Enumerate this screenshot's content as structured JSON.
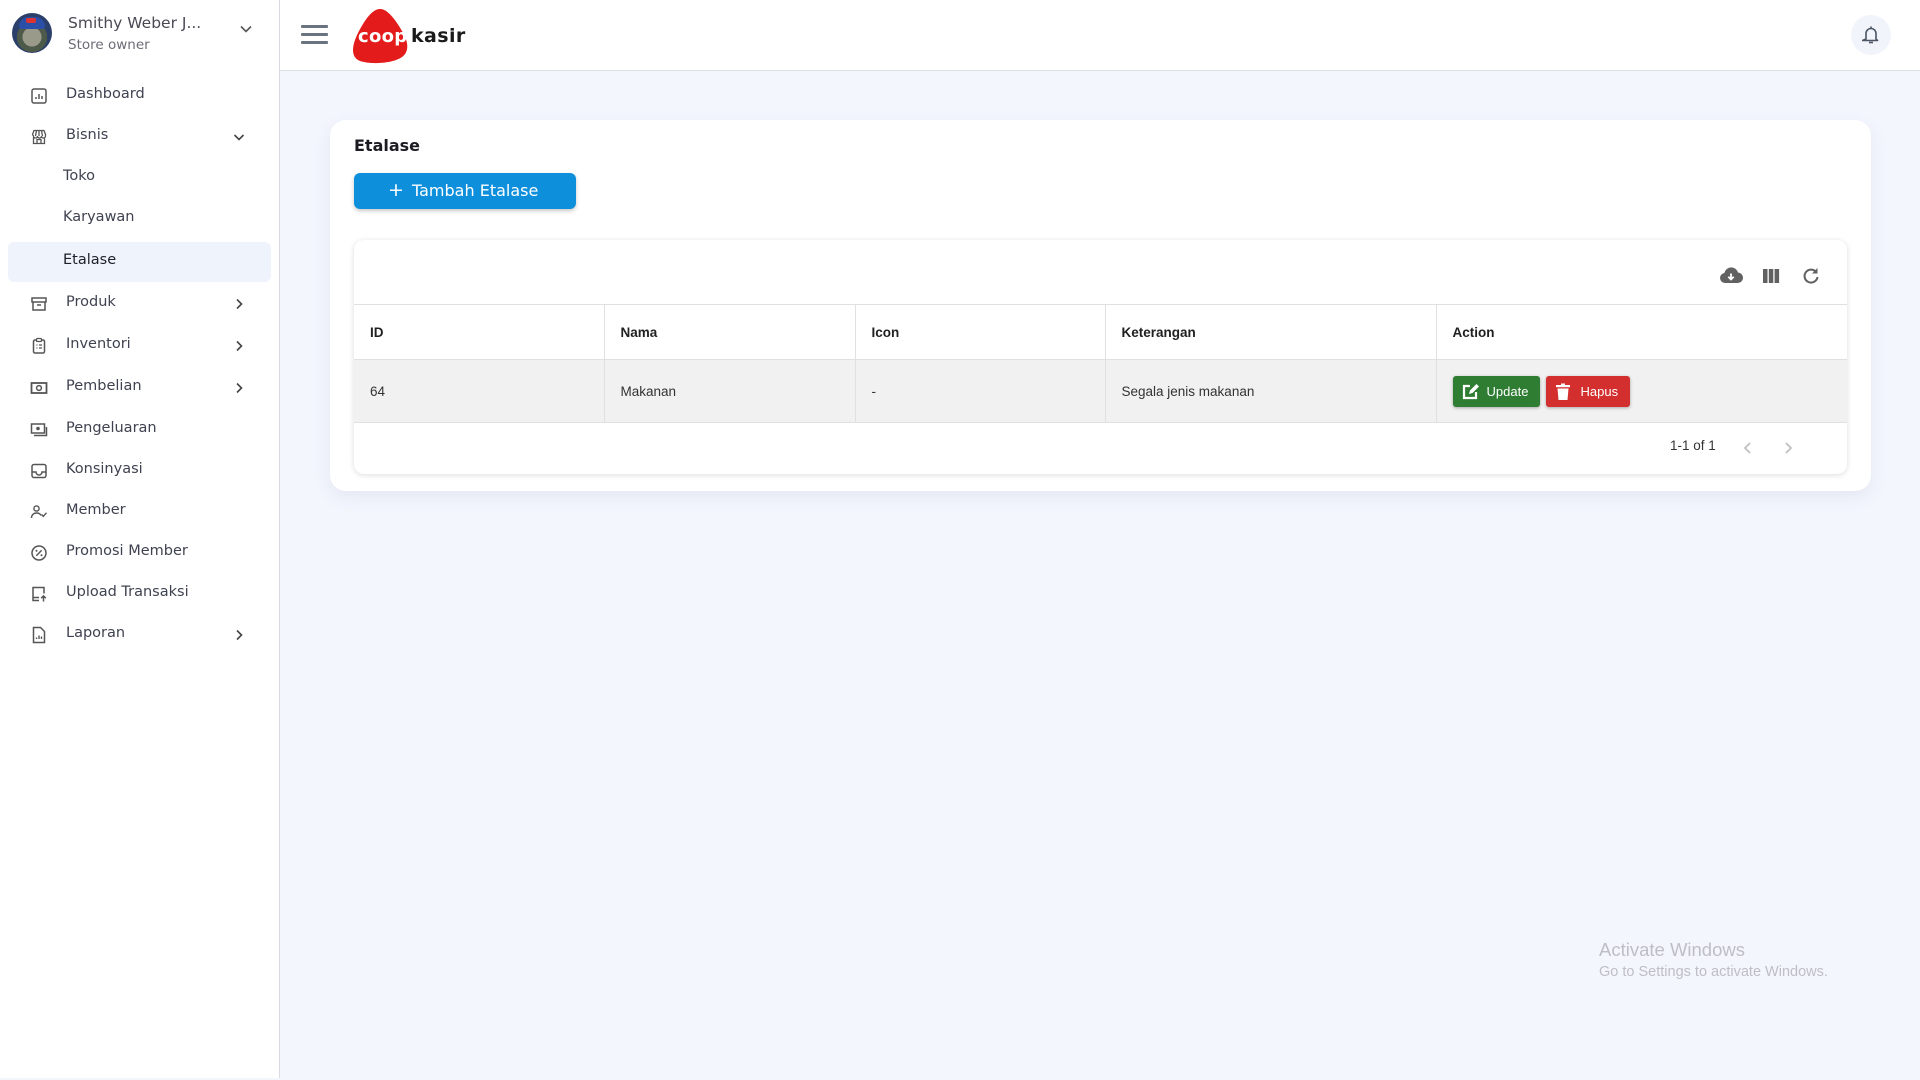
{
  "user": {
    "name": "Smithy Weber J...",
    "role": "Store owner"
  },
  "sidebar": {
    "items": [
      {
        "label": "Dashboard",
        "icon": "dashboard-icon"
      },
      {
        "label": "Bisnis",
        "icon": "store-icon",
        "expanded": true
      },
      {
        "label": "Toko",
        "sub": true
      },
      {
        "label": "Karyawan",
        "sub": true
      },
      {
        "label": "Etalase",
        "sub": true,
        "active": true
      },
      {
        "label": "Produk",
        "icon": "archive-icon",
        "has_children": true
      },
      {
        "label": "Inventori",
        "icon": "clipboard-icon",
        "has_children": true
      },
      {
        "label": "Pembelian",
        "icon": "money-icon",
        "has_children": true
      },
      {
        "label": "Pengeluaran",
        "icon": "cash-icon"
      },
      {
        "label": "Konsinyasi",
        "icon": "inbox-icon"
      },
      {
        "label": "Member",
        "icon": "user-check-icon"
      },
      {
        "label": "Promosi Member",
        "icon": "discount-icon"
      },
      {
        "label": "Upload Transaksi",
        "icon": "upload-icon"
      },
      {
        "label": "Laporan",
        "icon": "report-icon",
        "has_children": true
      }
    ]
  },
  "header": {
    "logo_primary": "coop",
    "logo_secondary": "kasir",
    "brand_color": "#e31b1b"
  },
  "page": {
    "title": "Etalase",
    "add_button": "Tambah Etalase",
    "add_icon": "+"
  },
  "table": {
    "toolbar": [
      "download-icon",
      "columns-icon",
      "refresh-icon"
    ],
    "columns": [
      "ID",
      "Nama",
      "Icon",
      "Keterangan",
      "Action"
    ],
    "rows": [
      {
        "id": "64",
        "nama": "Makanan",
        "icon": "-",
        "keterangan": "Segala jenis makanan"
      }
    ],
    "actions": {
      "update": "Update",
      "delete": "Hapus"
    },
    "pagination": "1-1 of 1"
  },
  "colors": {
    "primary": "#0e8fdc",
    "update": "#2e7d32",
    "delete": "#d32f2f"
  },
  "watermark": {
    "title": "Activate Windows",
    "subtitle": "Go to Settings to activate Windows."
  }
}
